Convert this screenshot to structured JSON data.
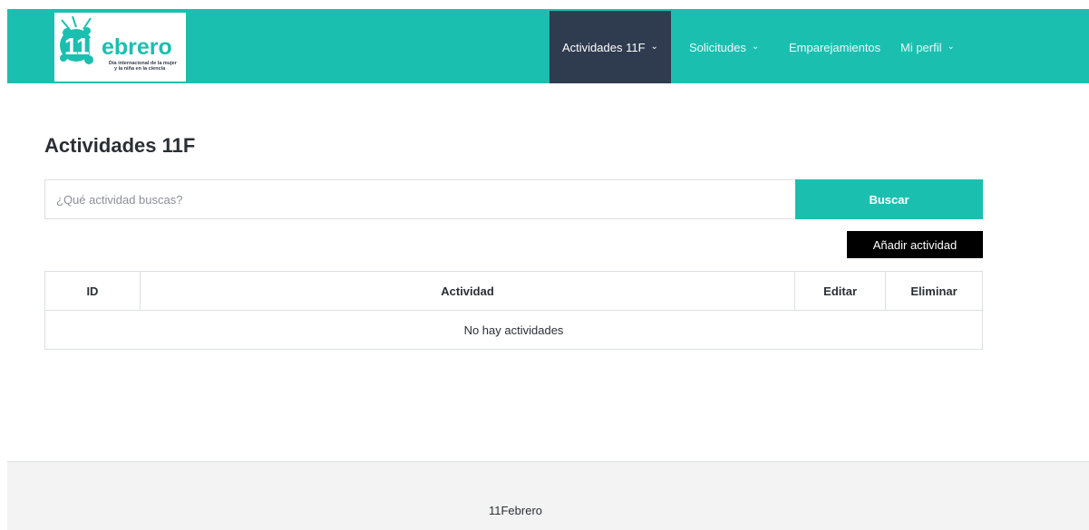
{
  "brand": {
    "logo_text": "11Febrero",
    "logo_tagline_1": "Día internacional de la mujer",
    "logo_tagline_2": "y la niña en la ciencia"
  },
  "nav": {
    "items": [
      {
        "label": "Actividades 11F",
        "active": true
      },
      {
        "label": "Solicitudes",
        "active": false
      },
      {
        "label": "Emparejamientos",
        "active": false
      },
      {
        "label": "Mi perfil",
        "active": false
      }
    ]
  },
  "main": {
    "title": "Actividades 11F",
    "search_placeholder": "¿Qué actividad buscas?",
    "search_button": "Buscar",
    "add_button": "Añadir actividad",
    "table": {
      "headers": [
        "ID",
        "Actividad",
        "Editar",
        "Eliminar"
      ],
      "empty_message": "No hay actividades"
    }
  },
  "footer": {
    "text": "11Febrero"
  },
  "colors": {
    "primary": "#1bbfb0",
    "nav_active": "#2f3b4f",
    "add_button": "#000000",
    "footer_bg": "#f3f3f3"
  },
  "icons": {
    "nav_dropdown": "chevron-down-icon"
  }
}
